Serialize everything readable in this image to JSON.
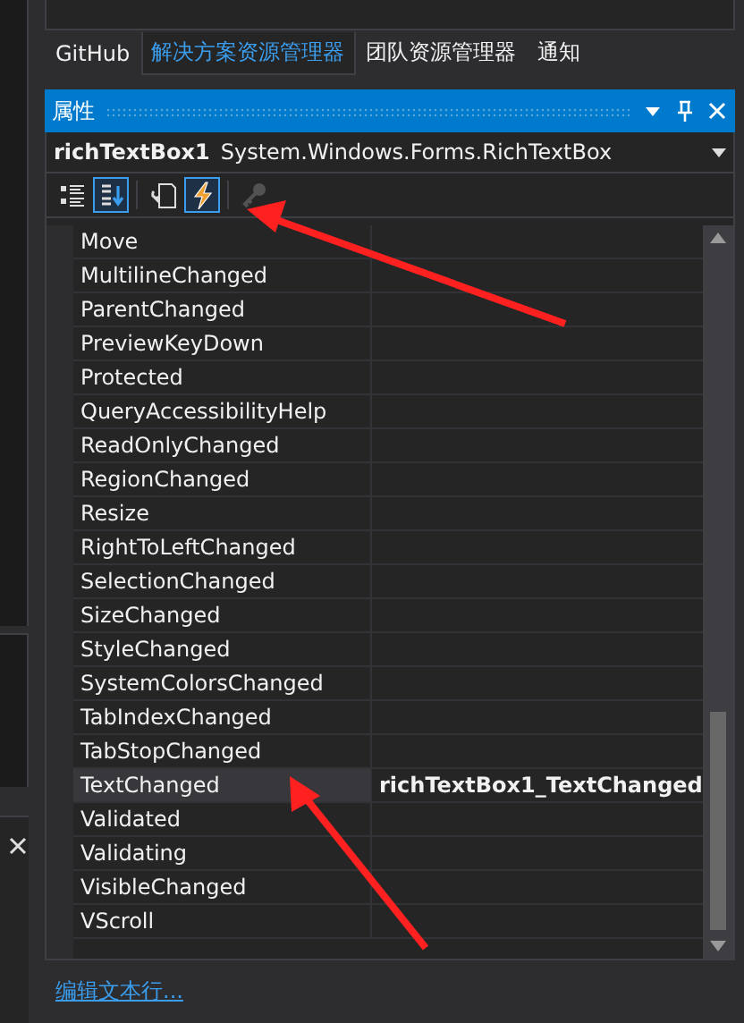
{
  "tabs": [
    {
      "label": "GitHub",
      "selected": false
    },
    {
      "label": "解决方案资源管理器",
      "selected": true
    },
    {
      "label": "团队资源管理器",
      "selected": false
    },
    {
      "label": "通知",
      "selected": false
    }
  ],
  "panel": {
    "title": "属性"
  },
  "object": {
    "name": "richTextBox1",
    "type": "System.Windows.Forms.RichTextBox"
  },
  "toolbar": [
    {
      "kind": "categorized",
      "selected": false,
      "disabled": false
    },
    {
      "kind": "alphabetical",
      "selected": true,
      "disabled": false
    },
    {
      "kind": "properties",
      "selected": false,
      "disabled": false
    },
    {
      "kind": "events",
      "selected": true,
      "disabled": false
    },
    {
      "kind": "pages",
      "selected": false,
      "disabled": true
    }
  ],
  "events": [
    {
      "name": "Move",
      "selected": false
    },
    {
      "name": "MultilineChanged",
      "selected": false
    },
    {
      "name": "ParentChanged",
      "selected": false
    },
    {
      "name": "PreviewKeyDown",
      "selected": false
    },
    {
      "name": "Protected",
      "selected": false
    },
    {
      "name": "QueryAccessibilityHelp",
      "selected": false
    },
    {
      "name": "ReadOnlyChanged",
      "selected": false
    },
    {
      "name": "RegionChanged",
      "selected": false
    },
    {
      "name": "Resize",
      "selected": false
    },
    {
      "name": "RightToLeftChanged",
      "selected": false
    },
    {
      "name": "SelectionChanged",
      "selected": false
    },
    {
      "name": "SizeChanged",
      "selected": false
    },
    {
      "name": "StyleChanged",
      "selected": false
    },
    {
      "name": "SystemColorsChanged",
      "selected": false
    },
    {
      "name": "TabIndexChanged",
      "selected": false
    },
    {
      "name": "TabStopChanged",
      "selected": false
    },
    {
      "name": "TextChanged",
      "value": "richTextBox1_TextChanged",
      "selected": true
    },
    {
      "name": "Validated",
      "selected": false
    },
    {
      "name": "Validating",
      "selected": false
    },
    {
      "name": "VisibleChanged",
      "selected": false
    },
    {
      "name": "VScroll",
      "selected": false
    }
  ],
  "link": "编辑文本行..."
}
